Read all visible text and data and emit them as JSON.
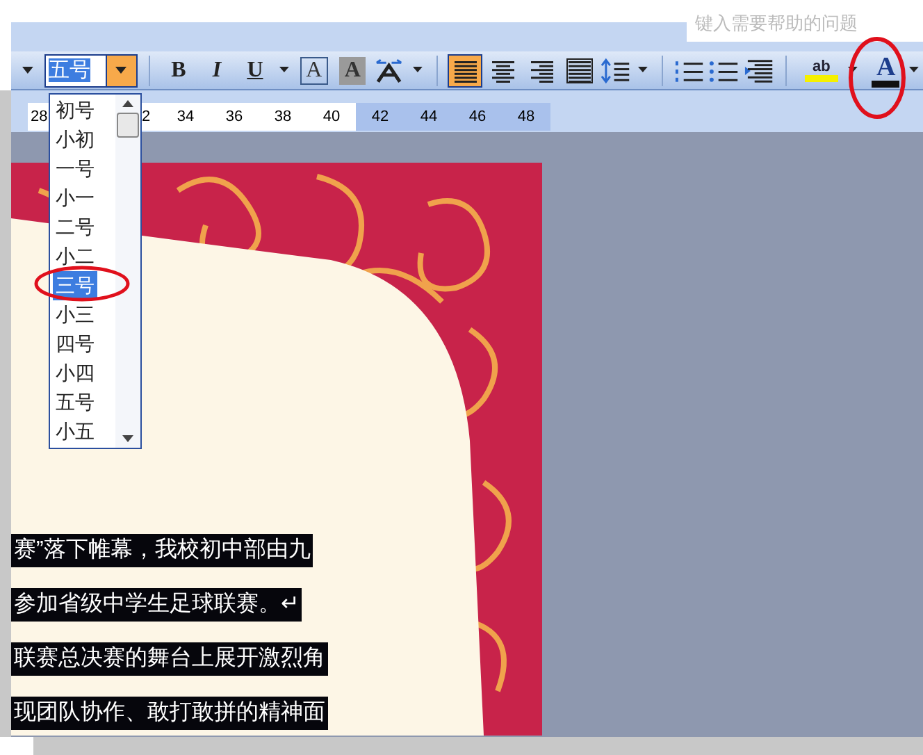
{
  "help_box": {
    "placeholder": "键入需要帮助的问题"
  },
  "font_size_box": {
    "value": "五号",
    "open": true
  },
  "toolbar": [
    {
      "kind": "bold",
      "label": "B"
    },
    {
      "kind": "italic",
      "label": "I"
    },
    {
      "kind": "underline",
      "label": "U"
    },
    {
      "kind": "caret"
    },
    {
      "kind": "char-border",
      "label": "A"
    },
    {
      "kind": "char-shading",
      "label": "A"
    },
    {
      "kind": "char-scale"
    },
    {
      "kind": "caret"
    },
    {
      "kind": "separator"
    },
    {
      "kind": "align-left",
      "selected": true
    },
    {
      "kind": "align-center",
      "selected": false
    },
    {
      "kind": "align-right",
      "selected": false
    },
    {
      "kind": "distribute",
      "selected": false
    },
    {
      "kind": "line-spacing"
    },
    {
      "kind": "caret"
    },
    {
      "kind": "separator"
    },
    {
      "kind": "numbered-list"
    },
    {
      "kind": "bullet-list"
    },
    {
      "kind": "indent"
    },
    {
      "kind": "separator"
    },
    {
      "kind": "highlight",
      "label": "ab"
    },
    {
      "kind": "caret"
    },
    {
      "kind": "font-color",
      "label": "A"
    },
    {
      "kind": "caret"
    }
  ],
  "ruler": [
    {
      "label": "28",
      "shaded": false
    },
    {
      "label": "2",
      "shaded": false
    },
    {
      "label": "34",
      "shaded": false
    },
    {
      "label": "36",
      "shaded": false
    },
    {
      "label": "38",
      "shaded": false
    },
    {
      "label": "40",
      "shaded": false
    },
    {
      "label": "42",
      "shaded": true
    },
    {
      "label": "44",
      "shaded": true
    },
    {
      "label": "46",
      "shaded": true
    },
    {
      "label": "48",
      "shaded": true
    }
  ],
  "size_list": [
    {
      "label": "初号",
      "selected": false
    },
    {
      "label": "小初",
      "selected": false
    },
    {
      "label": "一号",
      "selected": false
    },
    {
      "label": "小一",
      "selected": false
    },
    {
      "label": "二号",
      "selected": false
    },
    {
      "label": "小二",
      "selected": false
    },
    {
      "label": "三号",
      "selected": true
    },
    {
      "label": "小三",
      "selected": false
    },
    {
      "label": "四号",
      "selected": false
    },
    {
      "label": "小四",
      "selected": false
    },
    {
      "label": "五号",
      "selected": false
    },
    {
      "label": "小五",
      "selected": false
    }
  ],
  "document_lines": [
    "赛”落下帷幕，我校初中部由九",
    "参加省级中学生足球联赛。↵",
    "联赛总决赛的舞台上展开激烈角",
    "现团队协作、敢打敢拼的精神面"
  ]
}
